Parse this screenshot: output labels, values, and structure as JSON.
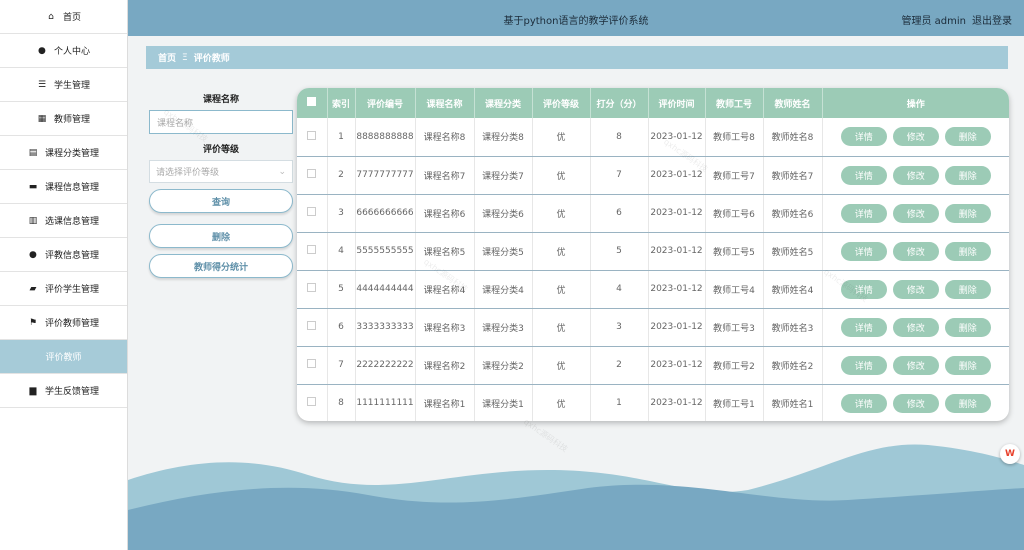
{
  "header": {
    "title": "基于python语言的教学评价系统",
    "user": "管理员 admin",
    "logout": "退出登录"
  },
  "sidebar": {
    "items": [
      {
        "label": "首页",
        "icon": "home-icon",
        "glyph": "⌂"
      },
      {
        "label": "个人中心",
        "icon": "user-icon",
        "glyph": "●"
      },
      {
        "label": "学生管理",
        "icon": "sliders-icon",
        "glyph": "☰"
      },
      {
        "label": "教师管理",
        "icon": "grid-icon",
        "glyph": "▦"
      },
      {
        "label": "课程分类管理",
        "icon": "layers-icon",
        "glyph": "▤"
      },
      {
        "label": "课程信息管理",
        "icon": "book-icon",
        "glyph": "▬"
      },
      {
        "label": "选课信息管理",
        "icon": "list-icon",
        "glyph": "▥"
      },
      {
        "label": "评教信息管理",
        "icon": "pin-icon",
        "glyph": "●"
      },
      {
        "label": "评价学生管理",
        "icon": "wallet-icon",
        "glyph": "▰"
      },
      {
        "label": "评价教师管理",
        "icon": "flag-icon",
        "glyph": "⚑"
      },
      {
        "label": "评价教师",
        "icon": "",
        "glyph": ""
      },
      {
        "label": "学生反馈管理",
        "icon": "briefcase-icon",
        "glyph": "▆"
      }
    ],
    "active_index": 10
  },
  "breadcrumb": {
    "home": "首页",
    "separator": "Ξ",
    "current": "评价教师"
  },
  "search": {
    "course_label": "课程名称",
    "course_placeholder": "课程名称",
    "grade_label": "评价等级",
    "grade_placeholder": "请选择评价等级",
    "query_btn": "查询",
    "delete_btn": "删除",
    "stats_btn": "教师得分统计"
  },
  "table": {
    "headers": [
      "",
      "索引",
      "评价编号",
      "课程名称",
      "课程分类",
      "评价等级",
      "打分（分）",
      "评价时间",
      "教师工号",
      "教师姓名",
      "操作"
    ],
    "rows": [
      {
        "idx": "1",
        "code": "8888888888",
        "course": "课程名称8",
        "cat": "课程分类8",
        "grade": "优",
        "score": "8",
        "time": "2023-01-12",
        "tid": "教师工号8",
        "tname": "教师姓名8"
      },
      {
        "idx": "2",
        "code": "7777777777",
        "course": "课程名称7",
        "cat": "课程分类7",
        "grade": "优",
        "score": "7",
        "time": "2023-01-12",
        "tid": "教师工号7",
        "tname": "教师姓名7"
      },
      {
        "idx": "3",
        "code": "6666666666",
        "course": "课程名称6",
        "cat": "课程分类6",
        "grade": "优",
        "score": "6",
        "time": "2023-01-12",
        "tid": "教师工号6",
        "tname": "教师姓名6"
      },
      {
        "idx": "4",
        "code": "5555555555",
        "course": "课程名称5",
        "cat": "课程分类5",
        "grade": "优",
        "score": "5",
        "time": "2023-01-12",
        "tid": "教师工号5",
        "tname": "教师姓名5"
      },
      {
        "idx": "5",
        "code": "4444444444",
        "course": "课程名称4",
        "cat": "课程分类4",
        "grade": "优",
        "score": "4",
        "time": "2023-01-12",
        "tid": "教师工号4",
        "tname": "教师姓名4"
      },
      {
        "idx": "6",
        "code": "3333333333",
        "course": "课程名称3",
        "cat": "课程分类3",
        "grade": "优",
        "score": "3",
        "time": "2023-01-12",
        "tid": "教师工号3",
        "tname": "教师姓名3"
      },
      {
        "idx": "7",
        "code": "2222222222",
        "course": "课程名称2",
        "cat": "课程分类2",
        "grade": "优",
        "score": "2",
        "time": "2023-01-12",
        "tid": "教师工号2",
        "tname": "教师姓名2"
      },
      {
        "idx": "8",
        "code": "1111111111",
        "course": "课程名称1",
        "cat": "课程分类1",
        "grade": "优",
        "score": "1",
        "time": "2023-01-12",
        "tid": "教师工号1",
        "tname": "教师姓名1"
      }
    ],
    "actions": {
      "detail": "详情",
      "edit": "修改",
      "delete": "删除"
    }
  },
  "colors": {
    "header": "#78a8c2",
    "breadcrumb": "#a4cad8",
    "table_header": "#9ccbb6",
    "action_button": "#9ccbb6",
    "active_nav": "#a6cbd8"
  }
}
